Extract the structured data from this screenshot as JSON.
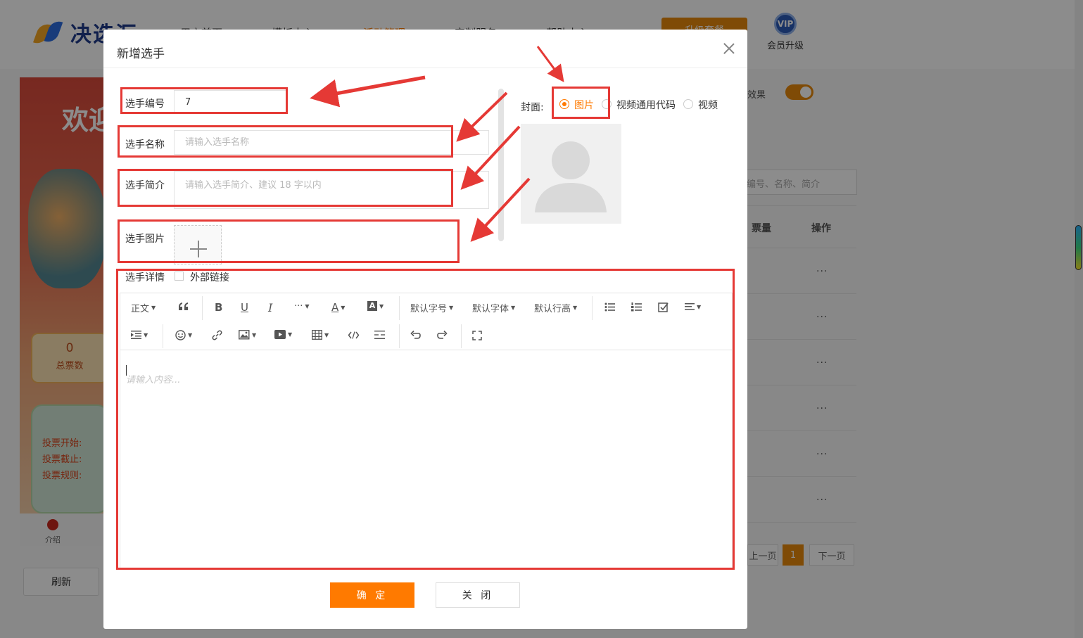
{
  "app": {
    "logo_text": "决选汇",
    "nav": [
      "用户首页",
      "模板中心",
      "活动管理",
      "定制服务",
      "帮助中心"
    ],
    "top_button": "升级套餐",
    "vip_badge": "VIP",
    "vip_label": "会员升级"
  },
  "background": {
    "poster_title": "欢迎",
    "stat_value": "0",
    "stat_label": "总票数",
    "info_lines": [
      "投票开始:",
      "投票截止:",
      "投票规则:"
    ],
    "footer_label": "介绍",
    "refresh": "刷新",
    "effect_label": "效果",
    "search_placeholder": "编号、名称、简介",
    "col_count": "票量",
    "col_action": "操作",
    "more": "···",
    "pager_prev": "上一页",
    "pager_current": "1",
    "pager_next": "下一页"
  },
  "modal": {
    "title": "新增选手",
    "fields": {
      "number_label": "选手编号",
      "number_value": "7",
      "name_label": "选手名称",
      "name_placeholder": "请输入选手名称",
      "intro_label": "选手简介",
      "intro_placeholder": "请输入选手简介、建议 18 字以内",
      "image_label": "选手图片",
      "detail_label": "选手详情",
      "external_link_label": "外部链接"
    },
    "cover": {
      "label": "封面:",
      "options": [
        "图片",
        "视频通用代码",
        "视频"
      ],
      "selected": "图片"
    },
    "editor": {
      "toolbar": {
        "paragraph": "正文",
        "font_size": "默认字号",
        "font_family": "默认字体",
        "line_height": "默认行高"
      },
      "placeholder": "请输入内容..."
    },
    "confirm": "确 定",
    "close": "关 闭"
  },
  "colors": {
    "accent": "#ff7a00",
    "annotation": "#e53935"
  }
}
